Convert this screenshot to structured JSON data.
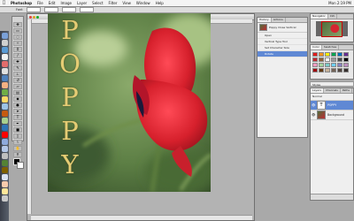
{
  "menubar": {
    "apple_icon": "apple-logo",
    "items": [
      "Photoshop",
      "File",
      "Edit",
      "Image",
      "Layer",
      "Select",
      "Filter",
      "View",
      "Window",
      "Help"
    ],
    "clock": "Mon 2:19 PM"
  },
  "options_bar": {
    "label": "Font"
  },
  "document": {
    "title": "Poppy.psd",
    "status_zoom": "",
    "status_doc": "",
    "poppy_letters": [
      "P",
      "O",
      "P",
      "P",
      "Y"
    ],
    "text_color": "#e5cc74"
  },
  "history_panel": {
    "tabs": [
      "History",
      "Actions"
    ],
    "snapshot_label": "Poppy Close Vertical",
    "steps": [
      "Open",
      "Vertical Type Tool",
      "Set Character Size",
      "Rotate"
    ],
    "selected_index": 3
  },
  "navigator_panel": {
    "tabs": [
      "Navigator",
      "Info"
    ],
    "zoom": ""
  },
  "swatches_panel": {
    "tabs": [
      "Color",
      "Swatches"
    ],
    "colors": [
      "#e21b1b",
      "#f7931e",
      "#fff200",
      "#00a651",
      "#0072bc",
      "#662d91",
      "#c1272d",
      "#8c6239",
      "#ffffff",
      "#999999",
      "#4d4d4d",
      "#000000",
      "#f49ac1",
      "#a3d39c",
      "#7accc8",
      "#6dcff6",
      "#8781bd",
      "#bd8cbf",
      "#9e0b0f",
      "#603913",
      "#c7b299",
      "#736357",
      "#534741",
      "#362f2d"
    ]
  },
  "styles_panel": {
    "label": "Styles"
  },
  "layers_panel": {
    "tabs": [
      "Layers",
      "Channels",
      "Paths"
    ],
    "mode": "Normal",
    "layers": [
      {
        "name": "POPPY",
        "kind": "text",
        "selected": true
      },
      {
        "name": "Background",
        "kind": "image",
        "selected": false
      }
    ]
  },
  "dock": {
    "icon_colors": [
      "#7aa0d8",
      "#d0d0d0",
      "#5b9bd5",
      "#f2f2f2",
      "#e36c6c",
      "#e0e0e0",
      "#4f81bd",
      "#f4b183",
      "#70ad47",
      "#ffd966",
      "#9dc3e6",
      "#c55a11",
      "#a9d18e",
      "#2e75b6",
      "#ff0000",
      "#8faadc",
      "#b4c7e7",
      "#bfbfbf",
      "#548235",
      "#7f6000",
      "#dae3f3",
      "#f8cbad",
      "#ffe699",
      "#c9c9c9"
    ]
  }
}
